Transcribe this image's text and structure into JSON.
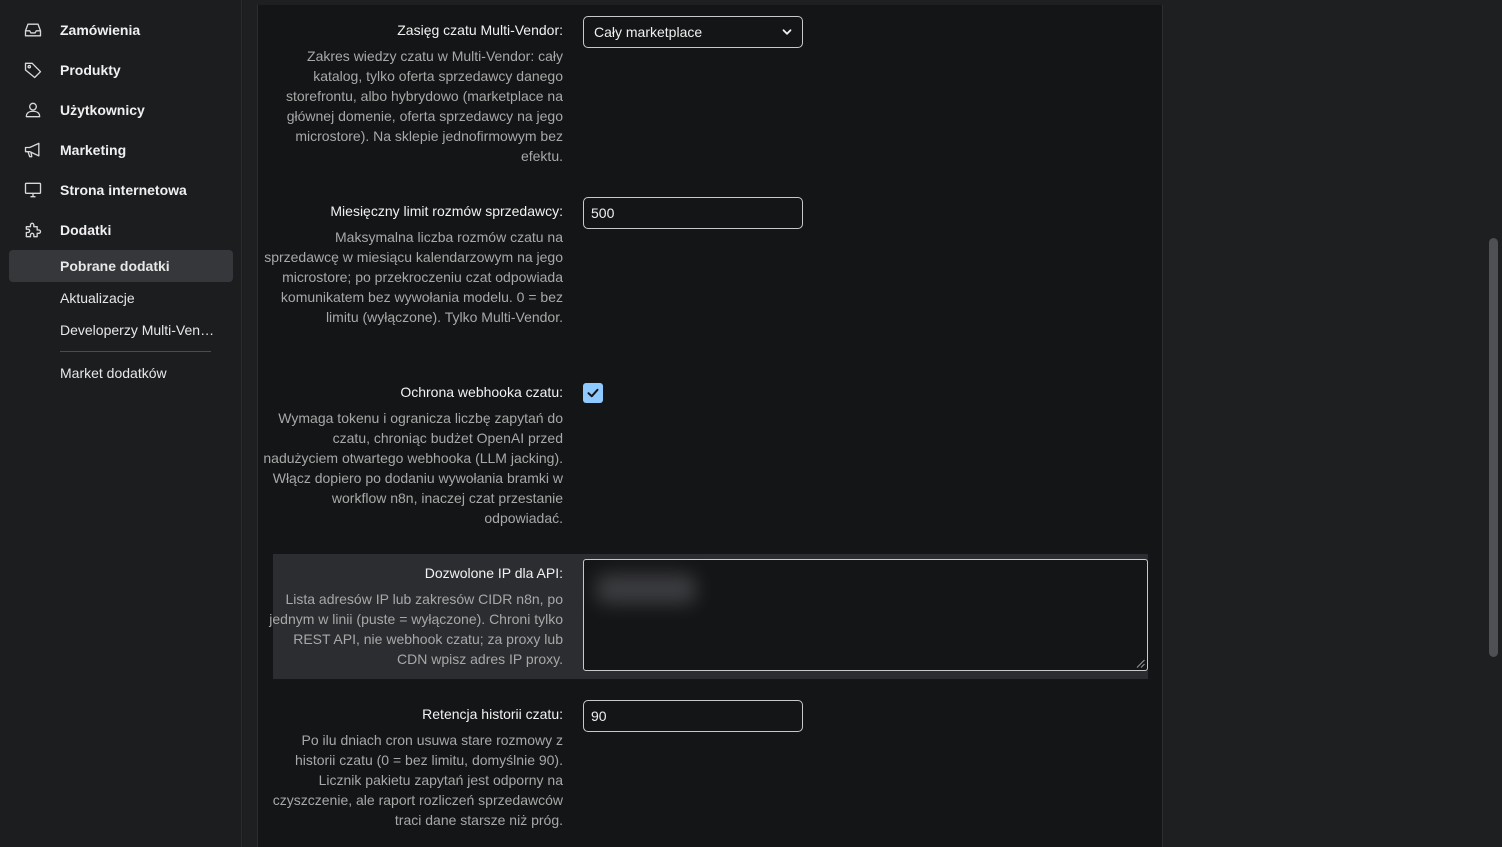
{
  "sidebar": {
    "items": [
      {
        "label": "Zamówienia",
        "icon": "inbox-icon"
      },
      {
        "label": "Produkty",
        "icon": "tag-icon"
      },
      {
        "label": "Użytkownicy",
        "icon": "user-icon"
      },
      {
        "label": "Marketing",
        "icon": "megaphone-icon"
      },
      {
        "label": "Strona internetowa",
        "icon": "monitor-icon"
      },
      {
        "label": "Dodatki",
        "icon": "puzzle-icon"
      }
    ],
    "subitems": [
      {
        "label": "Pobrane dodatki",
        "active": true
      },
      {
        "label": "Aktualizacje",
        "active": false
      },
      {
        "label": "Developerzy Multi-Vendor...",
        "active": false
      },
      {
        "label": "Market dodatków",
        "active": false
      }
    ]
  },
  "settings": {
    "scope": {
      "label": "Zasięg czatu Multi-Vendor:",
      "description": "Zakres wiedzy czatu w Multi-Vendor: cały katalog, tylko oferta sprzedawcy danego storefrontu, albo hybrydowo (marketplace na głównej domenie, oferta sprzedawcy na jego microstore). Na sklepie jednofirmowym bez efektu.",
      "value": "Cały marketplace"
    },
    "monthly_limit": {
      "label": "Miesięczny limit rozmów sprzedawcy:",
      "description": "Maksymalna liczba rozmów czatu na sprzedawcę w miesiącu kalendarzowym na jego microstore; po przekroczeniu czat odpowiada komunikatem bez wywołania modelu. 0 = bez limitu (wyłączone). Tylko Multi-Vendor.",
      "value": "500"
    },
    "webhook_protection": {
      "label": "Ochrona webhooka czatu:",
      "description": "Wymaga tokenu i ogranicza liczbę zapytań do czatu, chroniąc budżet OpenAI przed nadużyciem otwartego webhooka (LLM jacking). Włącz dopiero po dodaniu wywołania bramki w workflow n8n, inaczej czat przestanie odpowiadać.",
      "checked": true
    },
    "allowed_ips": {
      "label": "Dozwolone IP dla API:",
      "description": "Lista adresów IP lub zakresów CIDR n8n, po jednym w linii (puste = wyłączone). Chroni tylko REST API, nie webhook czatu; za proxy lub CDN wpisz adres IP proxy."
    },
    "retention": {
      "label": "Retencja historii czatu:",
      "description": "Po ilu dniach cron usuwa stare rozmowy z historii czatu (0 = bez limitu, domyślnie 90). Licznik pakietu zapytań jest odporny na czyszczenie, ale raport rozliczeń sprzedawców traci dane starsze niż próg.",
      "value": "90"
    }
  },
  "colors": {
    "accent_checkbox": "#8ec9ff",
    "active_subitem": "#35373a"
  }
}
